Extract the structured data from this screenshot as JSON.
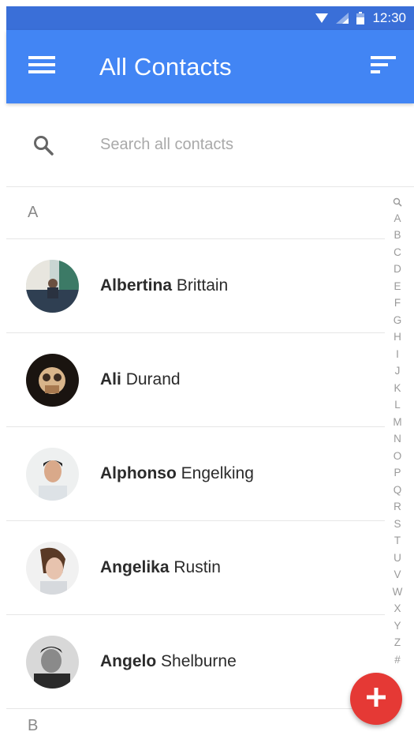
{
  "status_bar": {
    "time": "12:30",
    "icons": [
      "wifi-icon",
      "cell-signal-icon",
      "battery-icon"
    ]
  },
  "app_bar": {
    "title": "All Contacts",
    "menu_icon": "hamburger-menu-icon",
    "sort_icon": "sort-icon",
    "color": "#4285f4"
  },
  "search": {
    "placeholder": "Search all contacts",
    "value": "",
    "icon": "search-icon"
  },
  "sections": [
    {
      "letter": "A",
      "contacts": [
        {
          "first": "Albertina",
          "last": "Brittain"
        },
        {
          "first": "Ali",
          "last": "Durand"
        },
        {
          "first": "Alphonso",
          "last": "Engelking"
        },
        {
          "first": "Angelika",
          "last": "Rustin"
        },
        {
          "first": "Angelo",
          "last": "Shelburne"
        }
      ]
    },
    {
      "letter": "B",
      "contacts": []
    }
  ],
  "index": [
    "A",
    "B",
    "C",
    "D",
    "E",
    "F",
    "G",
    "H",
    "I",
    "J",
    "K",
    "L",
    "M",
    "N",
    "O",
    "P",
    "Q",
    "R",
    "S",
    "T",
    "U",
    "V",
    "W",
    "X",
    "Y",
    "Z",
    "#"
  ],
  "fab": {
    "icon": "plus-icon",
    "color": "#e53935"
  }
}
